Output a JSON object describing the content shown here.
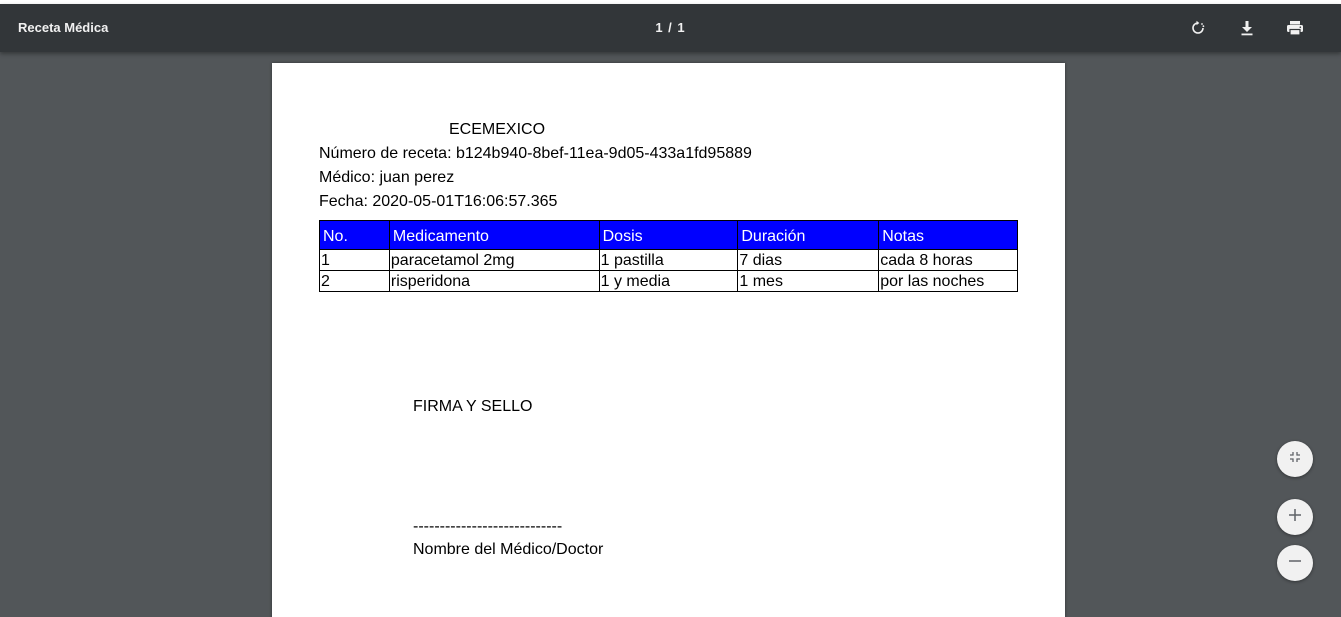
{
  "window": {
    "title": "Receta Médica"
  },
  "toolbar": {
    "page_indicator": "1 / 1",
    "icons": {
      "rotate": "rotate-icon",
      "download": "download-icon",
      "print": "print-icon"
    },
    "colors": {
      "toolbar_bg": "#323639",
      "viewer_bg": "#525659"
    }
  },
  "document": {
    "heading": "ECEMEXICO",
    "receta_number": "Número de receta: b124b940-8bef-11ea-9d05-433a1fd95889",
    "medico": "Médico: juan perez",
    "fecha": "Fecha: 2020-05-01T16:06:57.365",
    "table": {
      "header_color": "#0000ff",
      "columns": [
        "No.",
        "Medicamento",
        "Dosis",
        "Duración",
        "Notas"
      ],
      "rows": [
        [
          "1",
          "paracetamol 2mg",
          "1 pastilla",
          "7 dias",
          "cada 8 horas"
        ],
        [
          "2",
          "risperidona",
          "1 y media",
          "1 mes",
          "por las noches"
        ]
      ]
    },
    "signature_label": "FIRMA Y SELLO",
    "signature_line": "----------------------------",
    "signature_name": "Nombre del Médico/Doctor"
  },
  "zoom_controls": {
    "fit_icon": "fit-to-page-icon",
    "zoom_in_icon": "zoom-in-icon",
    "zoom_out_icon": "zoom-out-icon"
  }
}
